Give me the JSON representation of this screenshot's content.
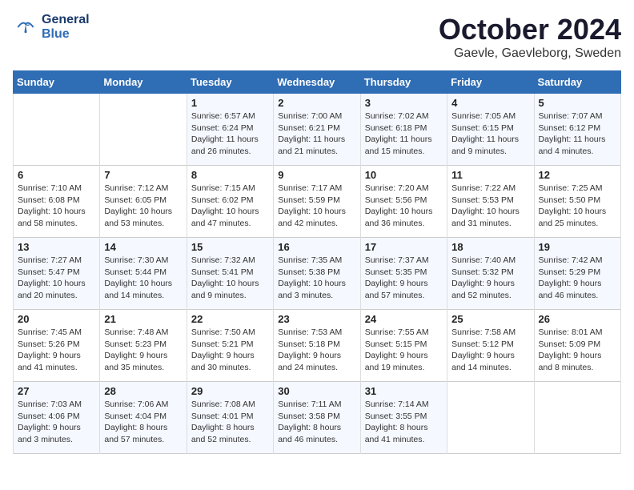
{
  "logo": {
    "line1": "General",
    "line2": "Blue"
  },
  "title": "October 2024",
  "subtitle": "Gaevle, Gaevleborg, Sweden",
  "weekdays": [
    "Sunday",
    "Monday",
    "Tuesday",
    "Wednesday",
    "Thursday",
    "Friday",
    "Saturday"
  ],
  "weeks": [
    [
      {
        "day": "",
        "info": ""
      },
      {
        "day": "",
        "info": ""
      },
      {
        "day": "1",
        "info": "Sunrise: 6:57 AM\nSunset: 6:24 PM\nDaylight: 11 hours and 26 minutes."
      },
      {
        "day": "2",
        "info": "Sunrise: 7:00 AM\nSunset: 6:21 PM\nDaylight: 11 hours and 21 minutes."
      },
      {
        "day": "3",
        "info": "Sunrise: 7:02 AM\nSunset: 6:18 PM\nDaylight: 11 hours and 15 minutes."
      },
      {
        "day": "4",
        "info": "Sunrise: 7:05 AM\nSunset: 6:15 PM\nDaylight: 11 hours and 9 minutes."
      },
      {
        "day": "5",
        "info": "Sunrise: 7:07 AM\nSunset: 6:12 PM\nDaylight: 11 hours and 4 minutes."
      }
    ],
    [
      {
        "day": "6",
        "info": "Sunrise: 7:10 AM\nSunset: 6:08 PM\nDaylight: 10 hours and 58 minutes."
      },
      {
        "day": "7",
        "info": "Sunrise: 7:12 AM\nSunset: 6:05 PM\nDaylight: 10 hours and 53 minutes."
      },
      {
        "day": "8",
        "info": "Sunrise: 7:15 AM\nSunset: 6:02 PM\nDaylight: 10 hours and 47 minutes."
      },
      {
        "day": "9",
        "info": "Sunrise: 7:17 AM\nSunset: 5:59 PM\nDaylight: 10 hours and 42 minutes."
      },
      {
        "day": "10",
        "info": "Sunrise: 7:20 AM\nSunset: 5:56 PM\nDaylight: 10 hours and 36 minutes."
      },
      {
        "day": "11",
        "info": "Sunrise: 7:22 AM\nSunset: 5:53 PM\nDaylight: 10 hours and 31 minutes."
      },
      {
        "day": "12",
        "info": "Sunrise: 7:25 AM\nSunset: 5:50 PM\nDaylight: 10 hours and 25 minutes."
      }
    ],
    [
      {
        "day": "13",
        "info": "Sunrise: 7:27 AM\nSunset: 5:47 PM\nDaylight: 10 hours and 20 minutes."
      },
      {
        "day": "14",
        "info": "Sunrise: 7:30 AM\nSunset: 5:44 PM\nDaylight: 10 hours and 14 minutes."
      },
      {
        "day": "15",
        "info": "Sunrise: 7:32 AM\nSunset: 5:41 PM\nDaylight: 10 hours and 9 minutes."
      },
      {
        "day": "16",
        "info": "Sunrise: 7:35 AM\nSunset: 5:38 PM\nDaylight: 10 hours and 3 minutes."
      },
      {
        "day": "17",
        "info": "Sunrise: 7:37 AM\nSunset: 5:35 PM\nDaylight: 9 hours and 57 minutes."
      },
      {
        "day": "18",
        "info": "Sunrise: 7:40 AM\nSunset: 5:32 PM\nDaylight: 9 hours and 52 minutes."
      },
      {
        "day": "19",
        "info": "Sunrise: 7:42 AM\nSunset: 5:29 PM\nDaylight: 9 hours and 46 minutes."
      }
    ],
    [
      {
        "day": "20",
        "info": "Sunrise: 7:45 AM\nSunset: 5:26 PM\nDaylight: 9 hours and 41 minutes."
      },
      {
        "day": "21",
        "info": "Sunrise: 7:48 AM\nSunset: 5:23 PM\nDaylight: 9 hours and 35 minutes."
      },
      {
        "day": "22",
        "info": "Sunrise: 7:50 AM\nSunset: 5:21 PM\nDaylight: 9 hours and 30 minutes."
      },
      {
        "day": "23",
        "info": "Sunrise: 7:53 AM\nSunset: 5:18 PM\nDaylight: 9 hours and 24 minutes."
      },
      {
        "day": "24",
        "info": "Sunrise: 7:55 AM\nSunset: 5:15 PM\nDaylight: 9 hours and 19 minutes."
      },
      {
        "day": "25",
        "info": "Sunrise: 7:58 AM\nSunset: 5:12 PM\nDaylight: 9 hours and 14 minutes."
      },
      {
        "day": "26",
        "info": "Sunrise: 8:01 AM\nSunset: 5:09 PM\nDaylight: 9 hours and 8 minutes."
      }
    ],
    [
      {
        "day": "27",
        "info": "Sunrise: 7:03 AM\nSunset: 4:06 PM\nDaylight: 9 hours and 3 minutes."
      },
      {
        "day": "28",
        "info": "Sunrise: 7:06 AM\nSunset: 4:04 PM\nDaylight: 8 hours and 57 minutes."
      },
      {
        "day": "29",
        "info": "Sunrise: 7:08 AM\nSunset: 4:01 PM\nDaylight: 8 hours and 52 minutes."
      },
      {
        "day": "30",
        "info": "Sunrise: 7:11 AM\nSunset: 3:58 PM\nDaylight: 8 hours and 46 minutes."
      },
      {
        "day": "31",
        "info": "Sunrise: 7:14 AM\nSunset: 3:55 PM\nDaylight: 8 hours and 41 minutes."
      },
      {
        "day": "",
        "info": ""
      },
      {
        "day": "",
        "info": ""
      }
    ]
  ]
}
